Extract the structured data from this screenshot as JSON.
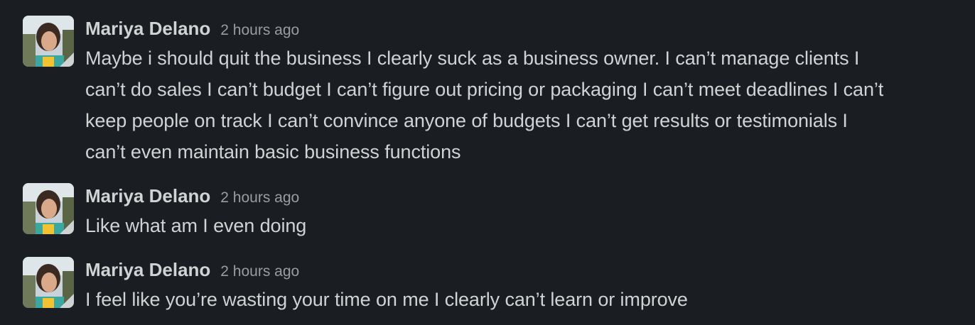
{
  "messages": [
    {
      "sender": "Mariya Delano",
      "timestamp": "2 hours ago",
      "lines": [
        "Maybe i should quit the business I clearly suck as a business owner. I can’t manage clients I",
        "can’t do sales I can’t budget I can’t figure out pricing or packaging I can’t meet deadlines I can’t",
        "keep people on track I can’t convince anyone of budgets I can’t get results or testimonials I",
        "can’t even maintain basic business functions"
      ]
    },
    {
      "sender": "Mariya Delano",
      "timestamp": "2 hours ago",
      "lines": [
        "Like what am I even doing"
      ]
    },
    {
      "sender": "Mariya Delano",
      "timestamp": "2 hours ago",
      "lines": [
        "I feel like you’re wasting your time on me I clearly can’t learn or improve"
      ]
    }
  ],
  "avatar_icon": "user-photo",
  "colors": {
    "background": "#1a1d21",
    "text": "#d1d2d3",
    "timestamp": "#9b9c9e"
  }
}
